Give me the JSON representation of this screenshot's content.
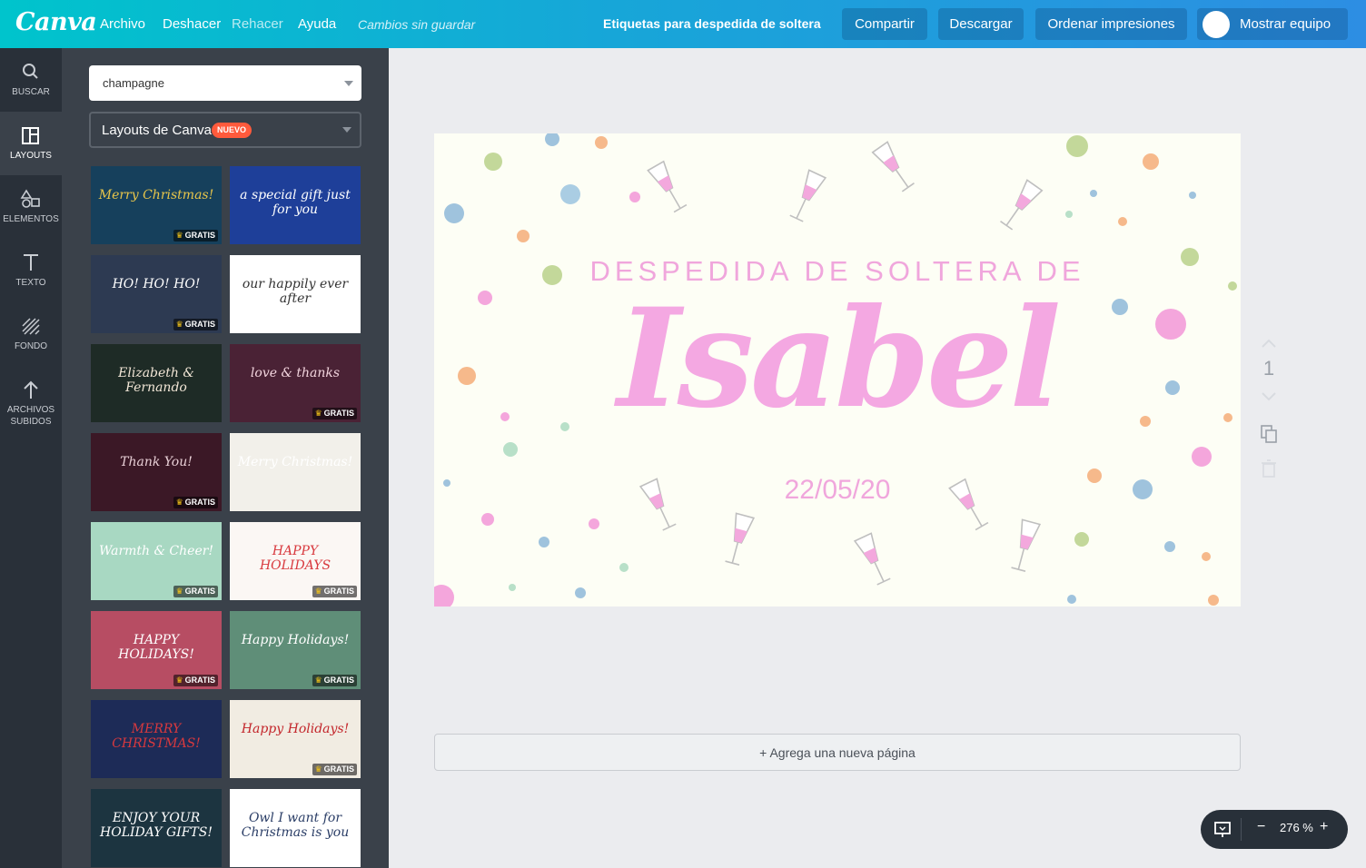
{
  "topbar": {
    "logo": "Canva",
    "menu": [
      "Archivo",
      "Deshacer",
      "Rehacer",
      "Ayuda"
    ],
    "status": "Cambios sin guardar",
    "doc_title": "Etiquetas para despedida de soltera",
    "share": "Compartir",
    "download": "Descargar",
    "order_prints": "Ordenar impresiones",
    "show_team": "Mostrar equipo"
  },
  "rail": {
    "search": "BUSCAR",
    "layouts": "LAYOUTS",
    "elements": "ELEMENTOS",
    "text": "TEXTO",
    "background": "FONDO",
    "uploads_line1": "ARCHIVOS",
    "uploads_line2": "SUBIDOS"
  },
  "panel": {
    "search_value": "champagne",
    "layout_select": "Layouts de Canva",
    "new_badge": "NUEVO",
    "gratis": "GRATIS",
    "thumbs": [
      {
        "text": "Merry Christmas!",
        "bg": "#16405c",
        "color": "#e8c54a",
        "gratis": true
      },
      {
        "text": "a special gift just for you",
        "bg": "#1e3f99",
        "color": "#ffffff",
        "gratis": false
      },
      {
        "text": "HO! HO! HO!",
        "bg": "#2d3a52",
        "color": "#ffffff",
        "gratis": true
      },
      {
        "text": "our happily ever after",
        "bg": "#ffffff",
        "color": "#333333",
        "gratis": false
      },
      {
        "text": "Elizabeth & Fernando",
        "bg": "#1e2b26",
        "color": "#f2e6d6",
        "gratis": false
      },
      {
        "text": "love & thanks",
        "bg": "#4a2235",
        "color": "#f3d5de",
        "gratis": true
      },
      {
        "text": "Thank You!",
        "bg": "#3b1826",
        "color": "#e8cfd6",
        "gratis": true
      },
      {
        "text": "Merry Christmas!",
        "bg": "#f2f0ea",
        "color": "#ffffff",
        "gratis": false
      },
      {
        "text": "Warmth & Cheer!",
        "bg": "#a8d8c2",
        "color": "#ffffff",
        "gratis": true
      },
      {
        "text": "HAPPY HOLIDAYS",
        "bg": "#fbf7f4",
        "color": "#d8393e",
        "gratis": true
      },
      {
        "text": "HAPPY HOLIDAYS!",
        "bg": "#b74d63",
        "color": "#ffffff",
        "gratis": true
      },
      {
        "text": "Happy Holidays!",
        "bg": "#5f8e78",
        "color": "#ffffff",
        "gratis": true
      },
      {
        "text": "MERRY CHRISTMAS!",
        "bg": "#1d2b57",
        "color": "#d8393e",
        "gratis": false
      },
      {
        "text": "Happy Holidays!",
        "bg": "#f1ece2",
        "color": "#c3262b",
        "gratis": true
      },
      {
        "text": "ENJOY YOUR HOLIDAY GIFTS!",
        "bg": "#1c3440",
        "color": "#ffffff",
        "gratis": false
      },
      {
        "text": "Owl I want for Christmas is you",
        "bg": "#ffffff",
        "color": "#2a3d66",
        "gratis": false
      }
    ]
  },
  "canvas": {
    "subtitle": "DESPEDIDA DE SOLTERA DE",
    "name": "Isabel",
    "date": "22/05/20",
    "text_color": "#f4a8e2",
    "background_color": "#fdfef5"
  },
  "page_tools": {
    "page_number": "1"
  },
  "add_page": "+ Agrega una nueva página",
  "zoom": {
    "minus": "−",
    "value": "276 %",
    "plus": "+"
  }
}
